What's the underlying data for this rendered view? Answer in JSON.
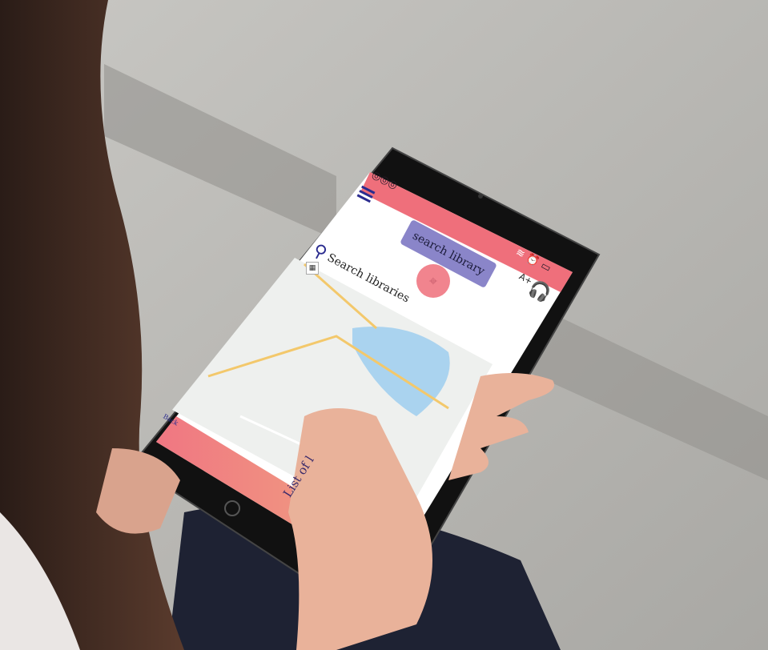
{
  "app": {
    "top_icons": [
      "coin-icon",
      "coin-icon",
      "coin-icon"
    ],
    "menu_icon": "hamburger-icon",
    "search": {
      "icon": "magnifier-icon",
      "placeholder_text": "Search libraries",
      "button_label": "search library"
    },
    "status_icons": [
      "wifi-icon",
      "alarm-icon",
      "battery-icon"
    ],
    "accessibility": {
      "font_size_label": "A+",
      "audio_icon": "headphones-icon"
    },
    "map": {
      "marker_icon": "location-pin-icon",
      "layer_toggle_label": "▦"
    },
    "footer": {
      "back_label": "Back",
      "list_label": "List of l"
    }
  },
  "colors": {
    "accent_pink": "#ef6f7b",
    "button_purple": "#8a85c9",
    "menu_blue": "#2b2c8f",
    "map_water": "#aad3ef",
    "map_land": "#eef0ee"
  }
}
